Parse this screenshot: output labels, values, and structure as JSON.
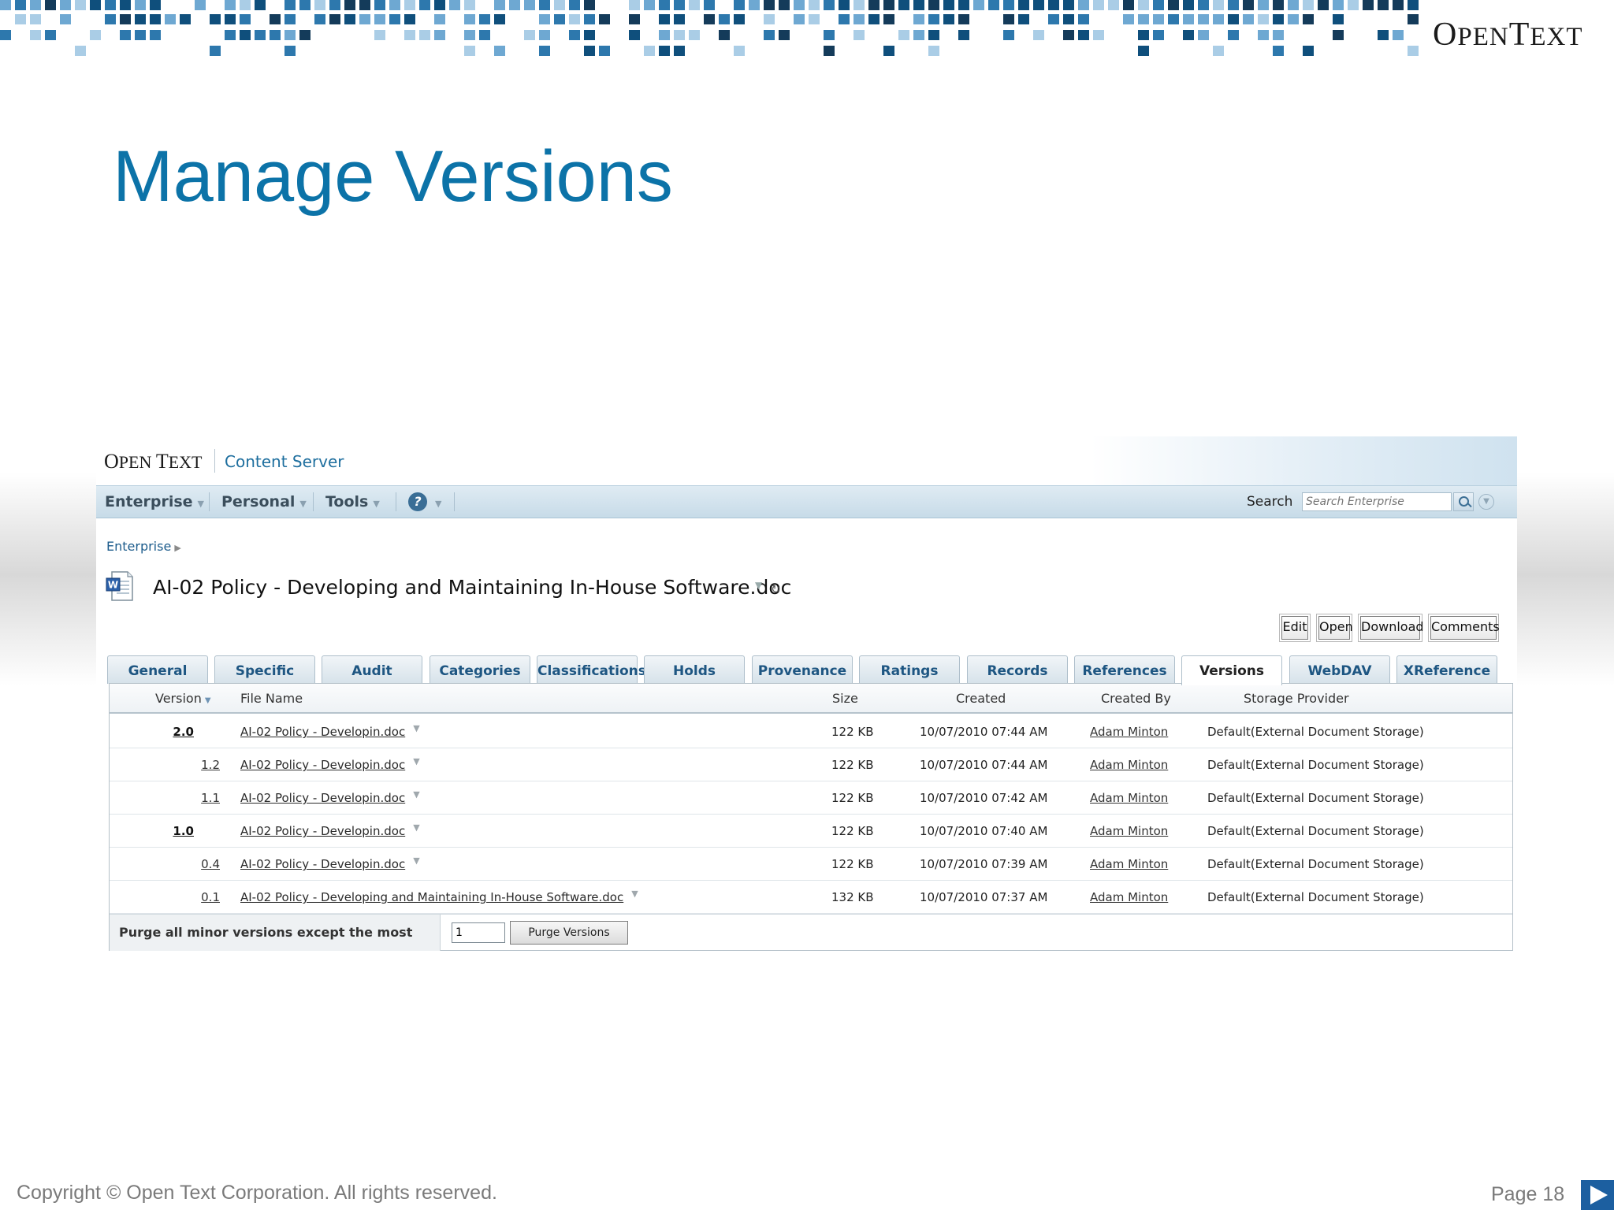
{
  "slide": {
    "title": "Manage Versions",
    "logo_big_o": "O",
    "logo_rest": "PEN",
    "logo_big_t": "T",
    "logo_rest2": "EXT",
    "copyright": "Copyright © Open Text Corporation. All rights reserved.",
    "page": "Page 18"
  },
  "app": {
    "logo_o": "O",
    "logo_pen": "PEN",
    "logo_t": "T",
    "logo_ext": "EXT",
    "product": "Content Server",
    "nav": {
      "enterprise": "Enterprise",
      "personal": "Personal",
      "tools": "Tools"
    },
    "search": {
      "label": "Search",
      "placeholder": "Search Enterprise"
    },
    "breadcrumb": "Enterprise",
    "document_title": "AI-02 Policy - Developing and Maintaining In-House Software.doc",
    "actions": [
      "Edit",
      "Open",
      "Download",
      "Comments"
    ],
    "tabs": [
      "General",
      "Specific",
      "Audit",
      "Categories",
      "Classifications",
      "Holds",
      "Provenance",
      "Ratings",
      "Records Detail",
      "References",
      "Versions",
      "WebDAV",
      "XReference"
    ],
    "active_tab": "Versions",
    "columns": {
      "version": "Version",
      "file_name": "File Name",
      "size": "Size",
      "created": "Created",
      "created_by": "Created By",
      "storage": "Storage Provider"
    },
    "rows": [
      {
        "version": "2.0",
        "major": true,
        "file": "AI-02  Policy  -  Developin.doc",
        "size": "122 KB",
        "created": "10/07/2010 07:44 AM",
        "by": "Adam Minton",
        "storage": "Default(External Document Storage)"
      },
      {
        "version": "1.2",
        "major": false,
        "file": "AI-02  Policy  -  Developin.doc",
        "size": "122 KB",
        "created": "10/07/2010 07:44 AM",
        "by": "Adam Minton",
        "storage": "Default(External Document Storage)"
      },
      {
        "version": "1.1",
        "major": false,
        "file": "AI-02  Policy  -  Developin.doc",
        "size": "122 KB",
        "created": "10/07/2010 07:42 AM",
        "by": "Adam Minton",
        "storage": "Default(External Document Storage)"
      },
      {
        "version": "1.0",
        "major": true,
        "file": "AI-02  Policy  -  Developin.doc",
        "size": "122 KB",
        "created": "10/07/2010 07:40 AM",
        "by": "Adam Minton",
        "storage": "Default(External Document Storage)"
      },
      {
        "version": "0.4",
        "major": false,
        "file": "AI-02  Policy  -  Developin.doc",
        "size": "122 KB",
        "created": "10/07/2010 07:39 AM",
        "by": "Adam Minton",
        "storage": "Default(External Document Storage)"
      },
      {
        "version": "0.1",
        "major": false,
        "file": "AI-02 Policy - Developing and Maintaining In-House Software.doc",
        "size": "132 KB",
        "created": "10/07/2010 07:37 AM",
        "by": "Adam Minton",
        "storage": "Default(External Document Storage)"
      }
    ],
    "purge": {
      "label": "Purge all minor versions except the most recent:",
      "value": "1",
      "button": "Purge Versions"
    }
  },
  "colors": {
    "title_blue": "#0c73a8",
    "link_blue": "#1e5682",
    "mosaic": [
      "#0f4f7c",
      "#2d78ad",
      "#6ea8d2",
      "#aacde6",
      "#143b5a"
    ]
  }
}
